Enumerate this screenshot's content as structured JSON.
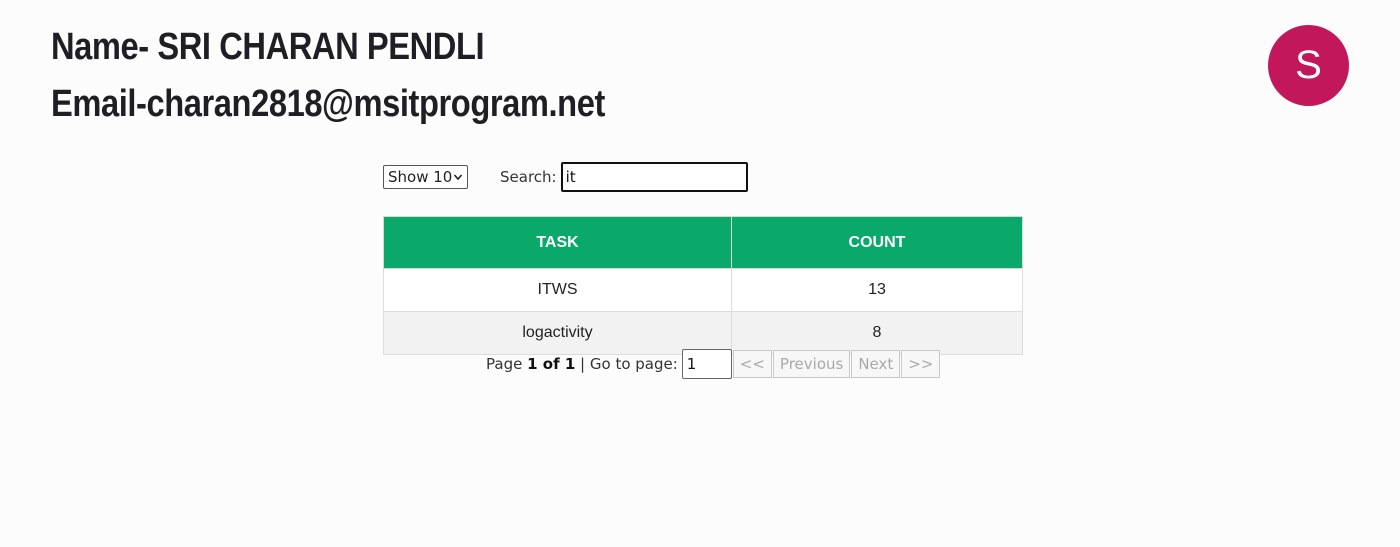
{
  "header": {
    "name": "Name- SRI CHARAN PENDLI",
    "email": "Email-charan2818@msitprogram.net"
  },
  "avatar": {
    "initial": "S",
    "color": "#c2185b"
  },
  "controls": {
    "show_value": "Show 10",
    "search_label": "Search:",
    "search_value": "it"
  },
  "table": {
    "header_color": "#0aa86b",
    "columns": [
      "TASK",
      "COUNT"
    ],
    "rows": [
      {
        "task": "ITWS",
        "count": "13"
      },
      {
        "task": "logactivity",
        "count": "8"
      }
    ]
  },
  "pagination": {
    "page_prefix": "Page",
    "page_of": "1 of 1",
    "goto_label": "| Go to page:",
    "goto_value": "1",
    "first_label": "<<",
    "prev_label": "Previous",
    "next_label": "Next",
    "last_label": ">>"
  }
}
